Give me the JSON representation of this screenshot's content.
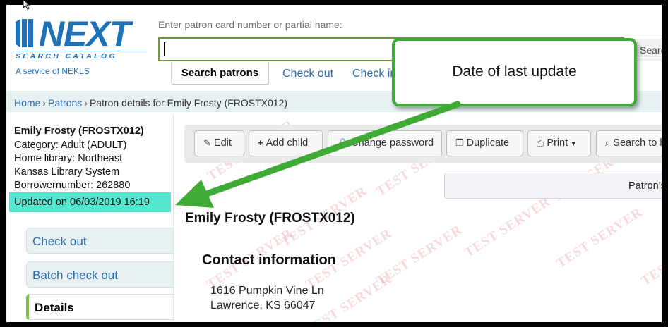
{
  "header": {
    "logo_word": "NEXT",
    "logo_sub": "SEARCH CATALOG",
    "logo_service": "A service of NEKLS",
    "search_hint": "Enter patron card number or partial name:",
    "search_value": "",
    "search_button": "Search"
  },
  "tabs": [
    {
      "label": "Search patrons"
    },
    {
      "label": "Check out"
    },
    {
      "label": "Check in"
    }
  ],
  "breadcrumb": {
    "home": "Home",
    "patrons": "Patrons",
    "sep": "›",
    "current": "Patron details for Emily Frosty (FROSTX012)"
  },
  "patron": {
    "name": "Emily Frosty (FROSTX012)",
    "category": "Category: Adult (ADULT)",
    "home_library_1": "Home library: Northeast",
    "home_library_2": "Kansas Library System",
    "borrowernumber": "Borrowernumber: 262880",
    "updated": "Updated on 06/03/2019 16:19"
  },
  "leftnav": [
    {
      "label": "Check out"
    },
    {
      "label": "Batch check out"
    },
    {
      "label": "Details"
    }
  ],
  "toolbar": {
    "edit": "Edit",
    "add_child": "Add child",
    "change_password": "Change password",
    "duplicate": "Duplicate",
    "print": "Print",
    "search_to": "Search to hold"
  },
  "patron_tab_strip": "Patron's",
  "main": {
    "name": "Emily Frosty (FROSTX012)",
    "contact_heading": "Contact information",
    "address_line1": "1616 Pumpkin Vine Ln",
    "address_line2": "Lawrence, KS 66047"
  },
  "watermark": "TEST SERVER",
  "callout": {
    "text": "Date of last update",
    "color": "#3faa36"
  },
  "colors": {
    "link": "#2a6cb0",
    "highlight": "#54e6cf",
    "brand": "#1f72b8"
  }
}
